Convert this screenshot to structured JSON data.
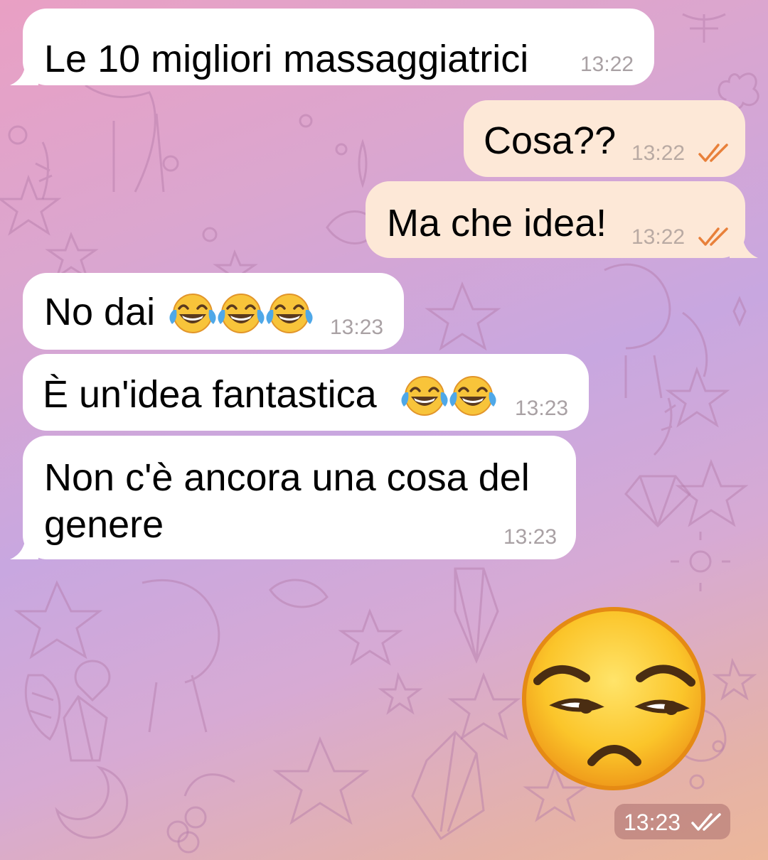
{
  "messages": [
    {
      "id": "m1",
      "direction": "incoming",
      "text": "Le 10 migliori massaggiatrici",
      "time": "13:22"
    },
    {
      "id": "m2",
      "direction": "outgoing",
      "text": "Cosa??",
      "time": "13:22",
      "status": "read"
    },
    {
      "id": "m3",
      "direction": "outgoing",
      "text": "Ma che idea!",
      "time": "13:22",
      "status": "read"
    },
    {
      "id": "m4",
      "direction": "incoming",
      "text": "No dai",
      "emoji_suffix": "😂😂😂",
      "time": "13:23"
    },
    {
      "id": "m5",
      "direction": "incoming",
      "text": "È un'idea fantastica",
      "emoji_suffix": "😂😂",
      "time": "13:23"
    },
    {
      "id": "m6",
      "direction": "incoming",
      "text_line1": "Non c'è ancora una cosa del",
      "text_line2": "genere",
      "time": "13:23"
    },
    {
      "id": "m7",
      "direction": "outgoing",
      "type": "sticker-emoji",
      "emoji": "unamused-face",
      "time": "13:23",
      "status": "read"
    }
  ],
  "colors": {
    "incoming_bubble": "#ffffff",
    "outgoing_bubble": "#fde8d7",
    "read_check": "#e8803a",
    "time_pill": "#b06e6e"
  }
}
